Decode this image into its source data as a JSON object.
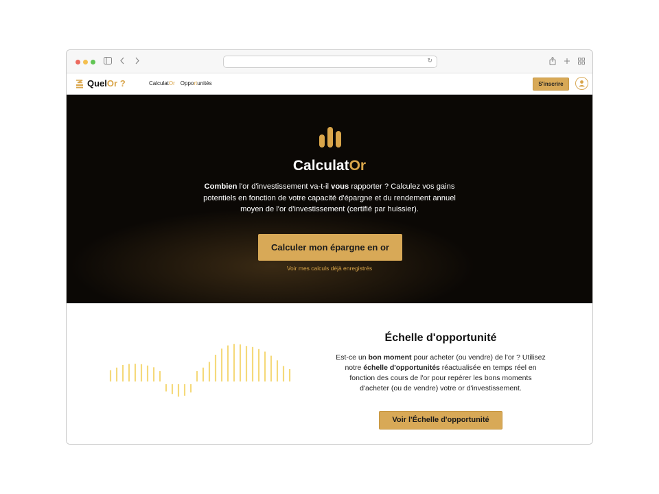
{
  "colors": {
    "gold": "#d9a54a",
    "button_gold": "#d8a957",
    "hero_bg": "#000000",
    "wave_bars": "#f5d97a"
  },
  "browser": {
    "traffic_lights": [
      "#ec6a5e",
      "#f4bf4f",
      "#61c554"
    ],
    "icons": [
      "sidebar-icon",
      "back-icon",
      "forward-icon",
      "reload-icon",
      "share-icon",
      "new-tab-icon",
      "tabs-overview-icon"
    ]
  },
  "header": {
    "logo_main": "Quel",
    "logo_accent": "Or ?",
    "nav": {
      "calculator_main": "Calculat",
      "calculator_accent": "Or",
      "opportunities_a": "Oppo",
      "opportunities_b": "rt",
      "opportunities_c": "unités"
    },
    "signup_label": "S'inscrire"
  },
  "hero": {
    "title_main": "Calculat",
    "title_accent": "Or",
    "desc": {
      "b1": "Combien",
      "t1": " l'or d'investissement va-t-il ",
      "b2": "vous",
      "t2": " rapporter ? Calculez vos gains potentiels en fonction de votre capacité d'épargne et du rendement annuel moyen de l'or d'investissement (certifié par huissier)."
    },
    "cta_label": "Calculer mon épargne en or",
    "saved_link": "Voir mes calculs déjà enregistrés"
  },
  "opportunity": {
    "title": "Échelle d'opportunité",
    "desc": {
      "t1": "Est-ce un ",
      "b1": "bon moment",
      "t2": " pour acheter (ou vendre) de l'or ? Utilisez notre ",
      "b2": "échelle d'opportunités",
      "t3": " réactualisée en temps réel en fonction des cours de l'or pour repérer les bons moments d'acheter (ou de vendre) votre or d'investissement."
    },
    "cta_label": "Voir l'Échelle d'opportunité",
    "wave_values": [
      0.3,
      0.55,
      0.8,
      0.9,
      0.92,
      0.88,
      0.75,
      0.58,
      0.2,
      -0.3,
      -0.55,
      -0.8,
      -0.72,
      -0.4,
      0.2,
      0.55,
      1.1,
      1.8,
      2.4,
      2.7,
      2.85,
      2.8,
      2.65,
      2.55,
      2.35,
      2.1,
      1.7,
      1.25,
      0.7,
      0.4
    ]
  }
}
